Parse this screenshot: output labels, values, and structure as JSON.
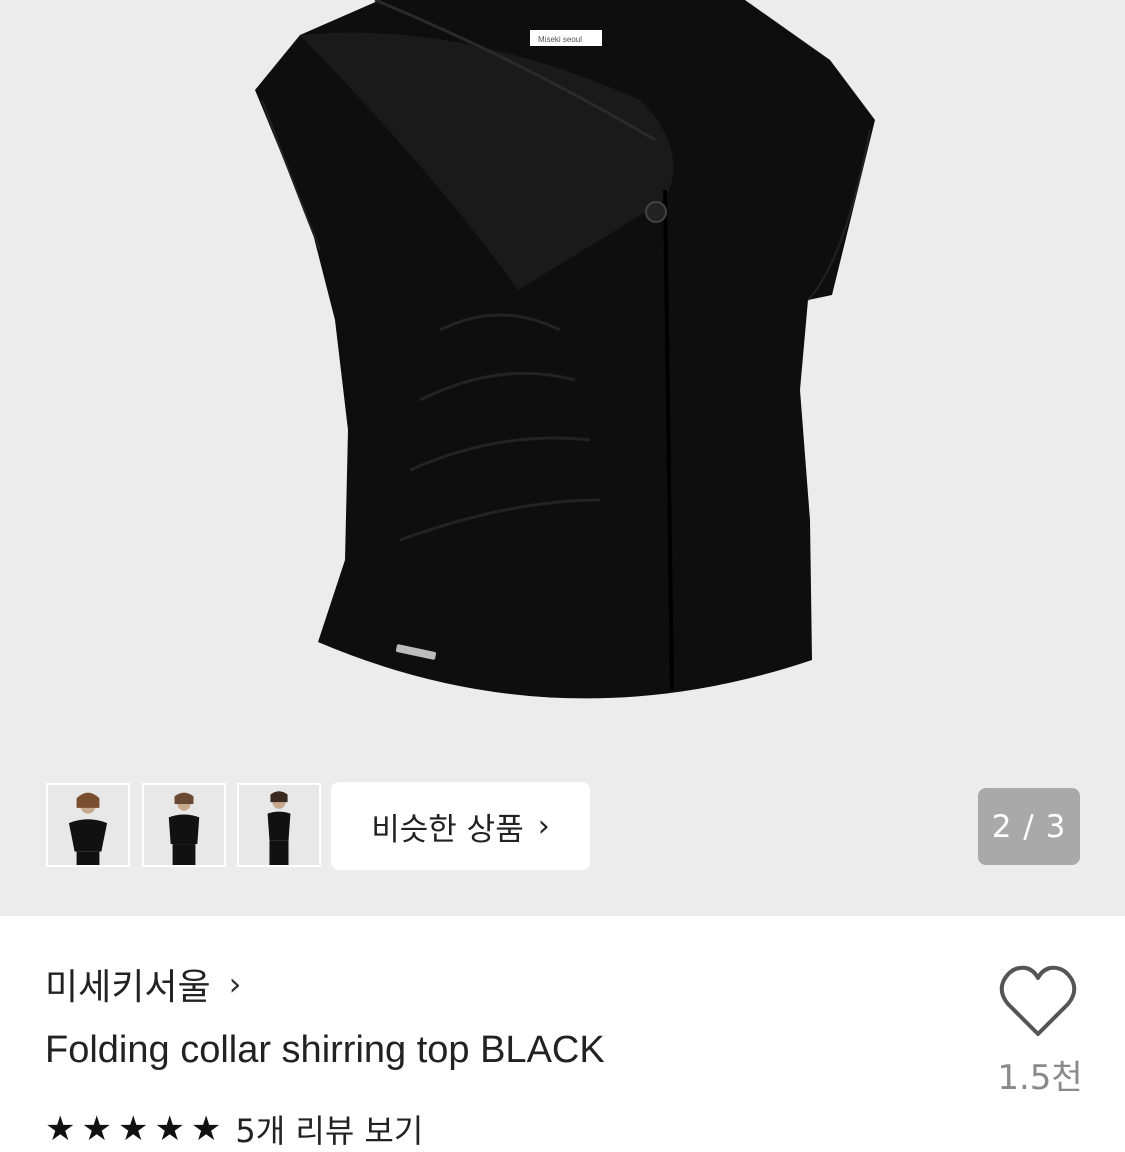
{
  "product_image": {
    "brand_tag": "Miseki seoul",
    "background_color": "#ececec",
    "garment_color": "#0e0e0e"
  },
  "gallery": {
    "thumbnails": [
      {
        "name": "thumbnail-1"
      },
      {
        "name": "thumbnail-2"
      },
      {
        "name": "thumbnail-3"
      }
    ],
    "similar_button_label": "비슷한 상품",
    "page_counter": "2 / 3"
  },
  "product": {
    "brand": "미세키서울",
    "title": "Folding collar shirring top BLACK",
    "like_count": "1.5천",
    "rating_stars": "★★★★★",
    "reviews_link": "5개 리뷰 보기"
  },
  "icons": {
    "chevron": "chevron-right-icon",
    "heart": "heart-outline-icon"
  }
}
